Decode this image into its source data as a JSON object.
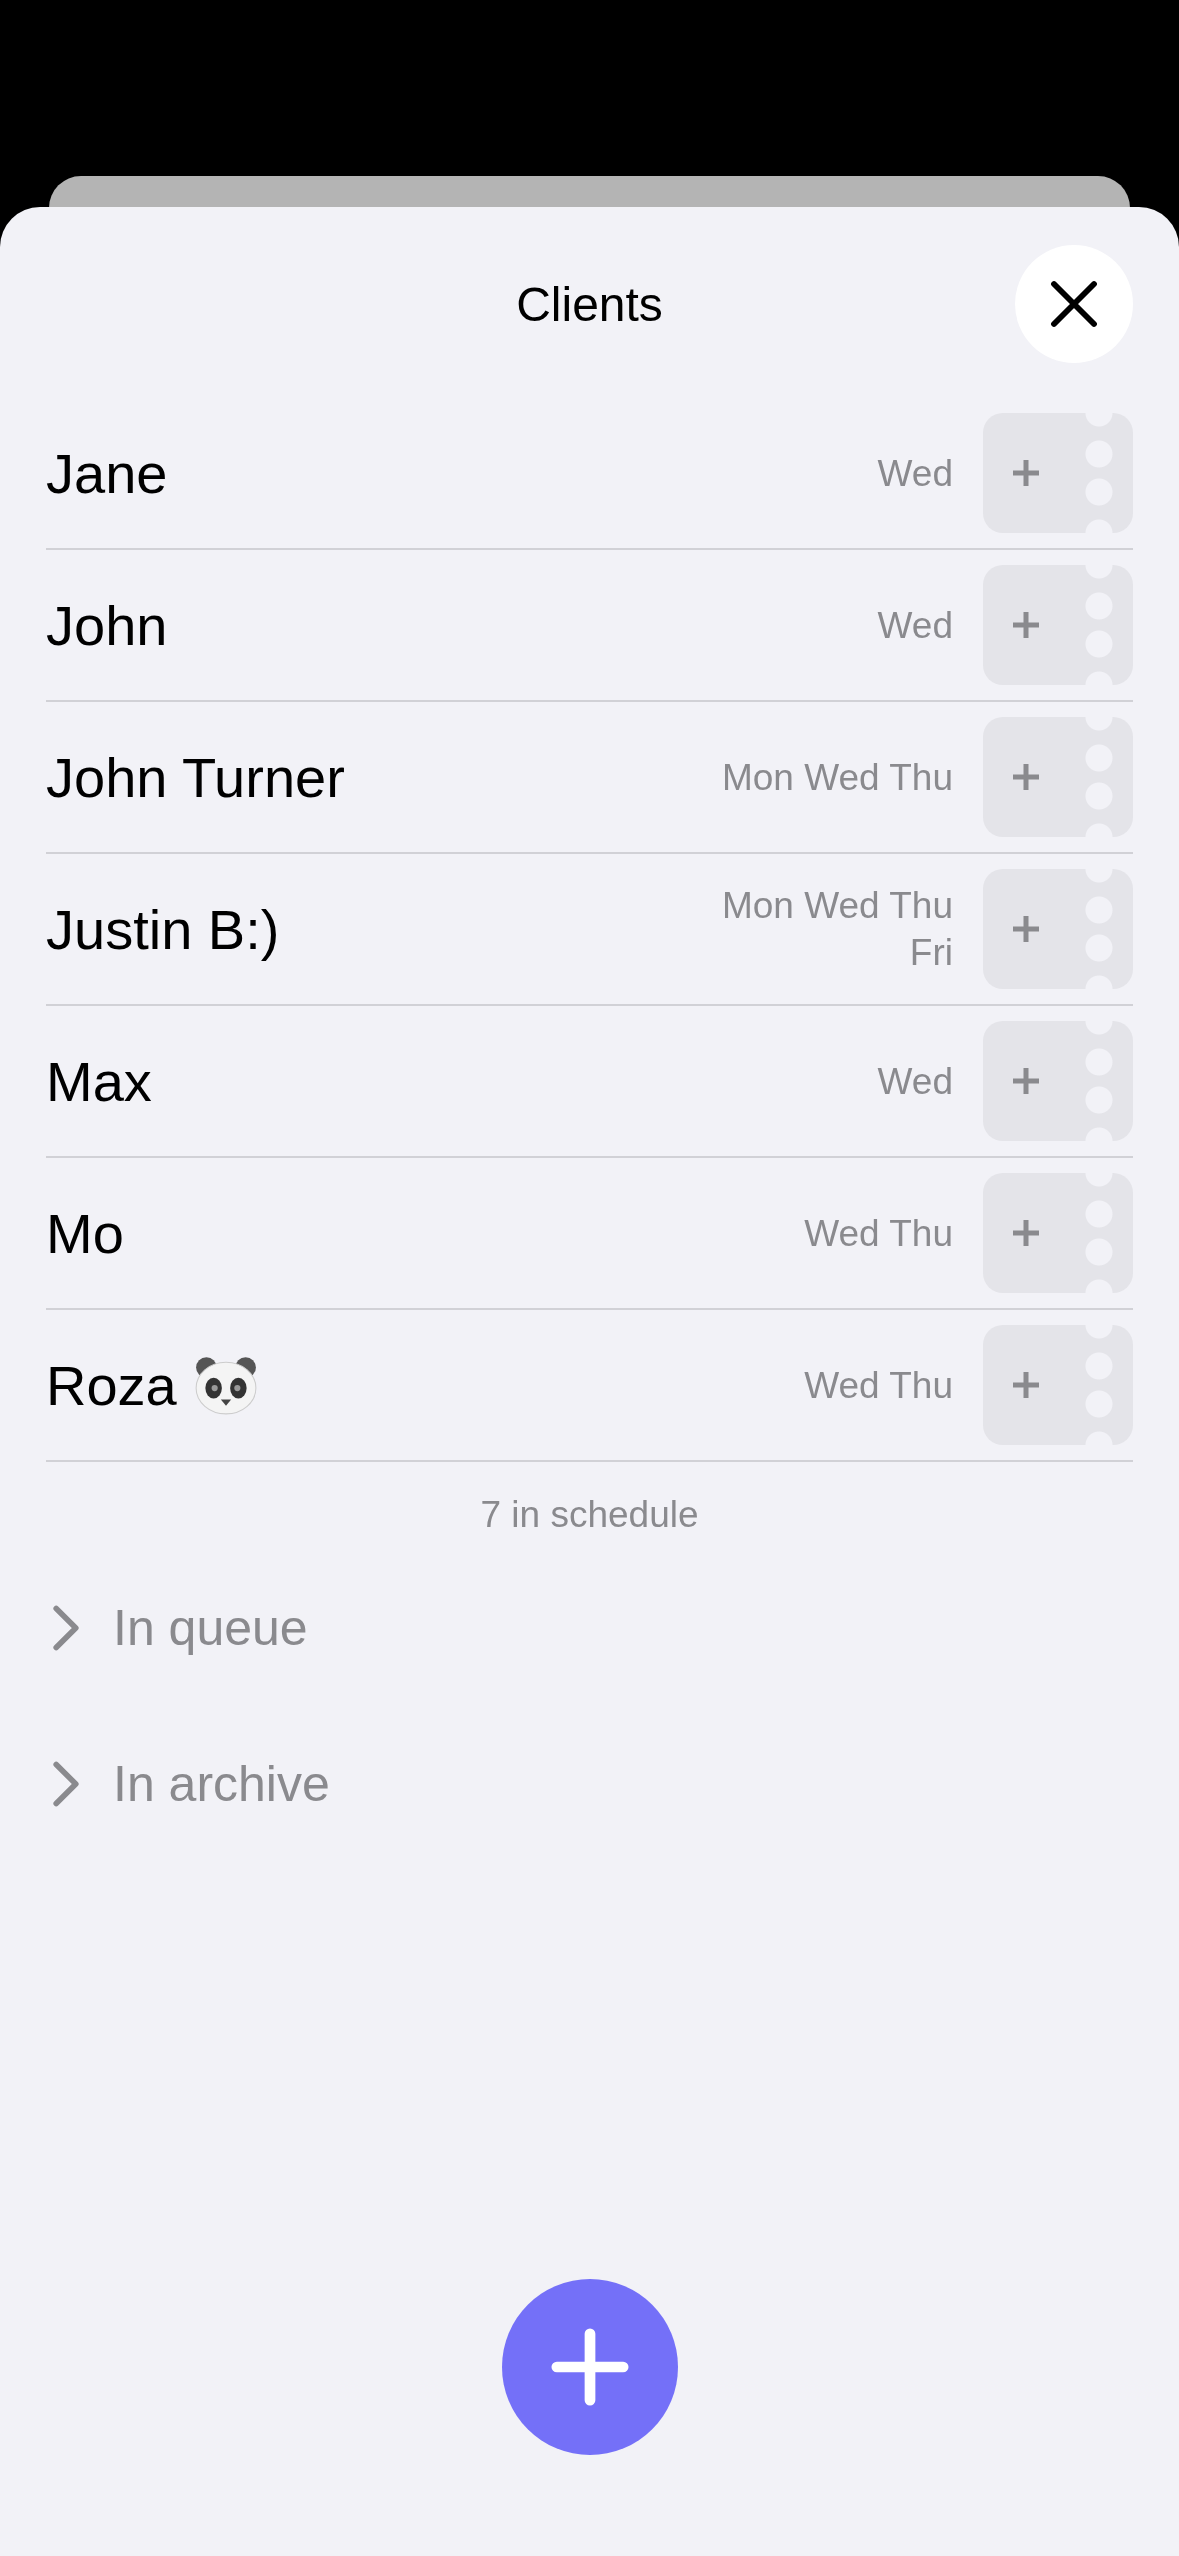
{
  "title": "Clients",
  "clients": [
    {
      "name": "Jane",
      "days": "Wed"
    },
    {
      "name": "John",
      "days": "Wed"
    },
    {
      "name": "John Turner",
      "days": "Mon Wed Thu"
    },
    {
      "name": "Justin B:)",
      "days": "Mon Wed Thu Fri"
    },
    {
      "name": "Max",
      "days": "Wed"
    },
    {
      "name": "Mo",
      "days": "Wed Thu"
    },
    {
      "name": "Roza",
      "days": "Wed Thu",
      "emoji": true
    }
  ],
  "summary": "7 in schedule",
  "sections": [
    {
      "label": "In queue",
      "expanded": false
    },
    {
      "label": "In archive",
      "expanded": false
    }
  ]
}
